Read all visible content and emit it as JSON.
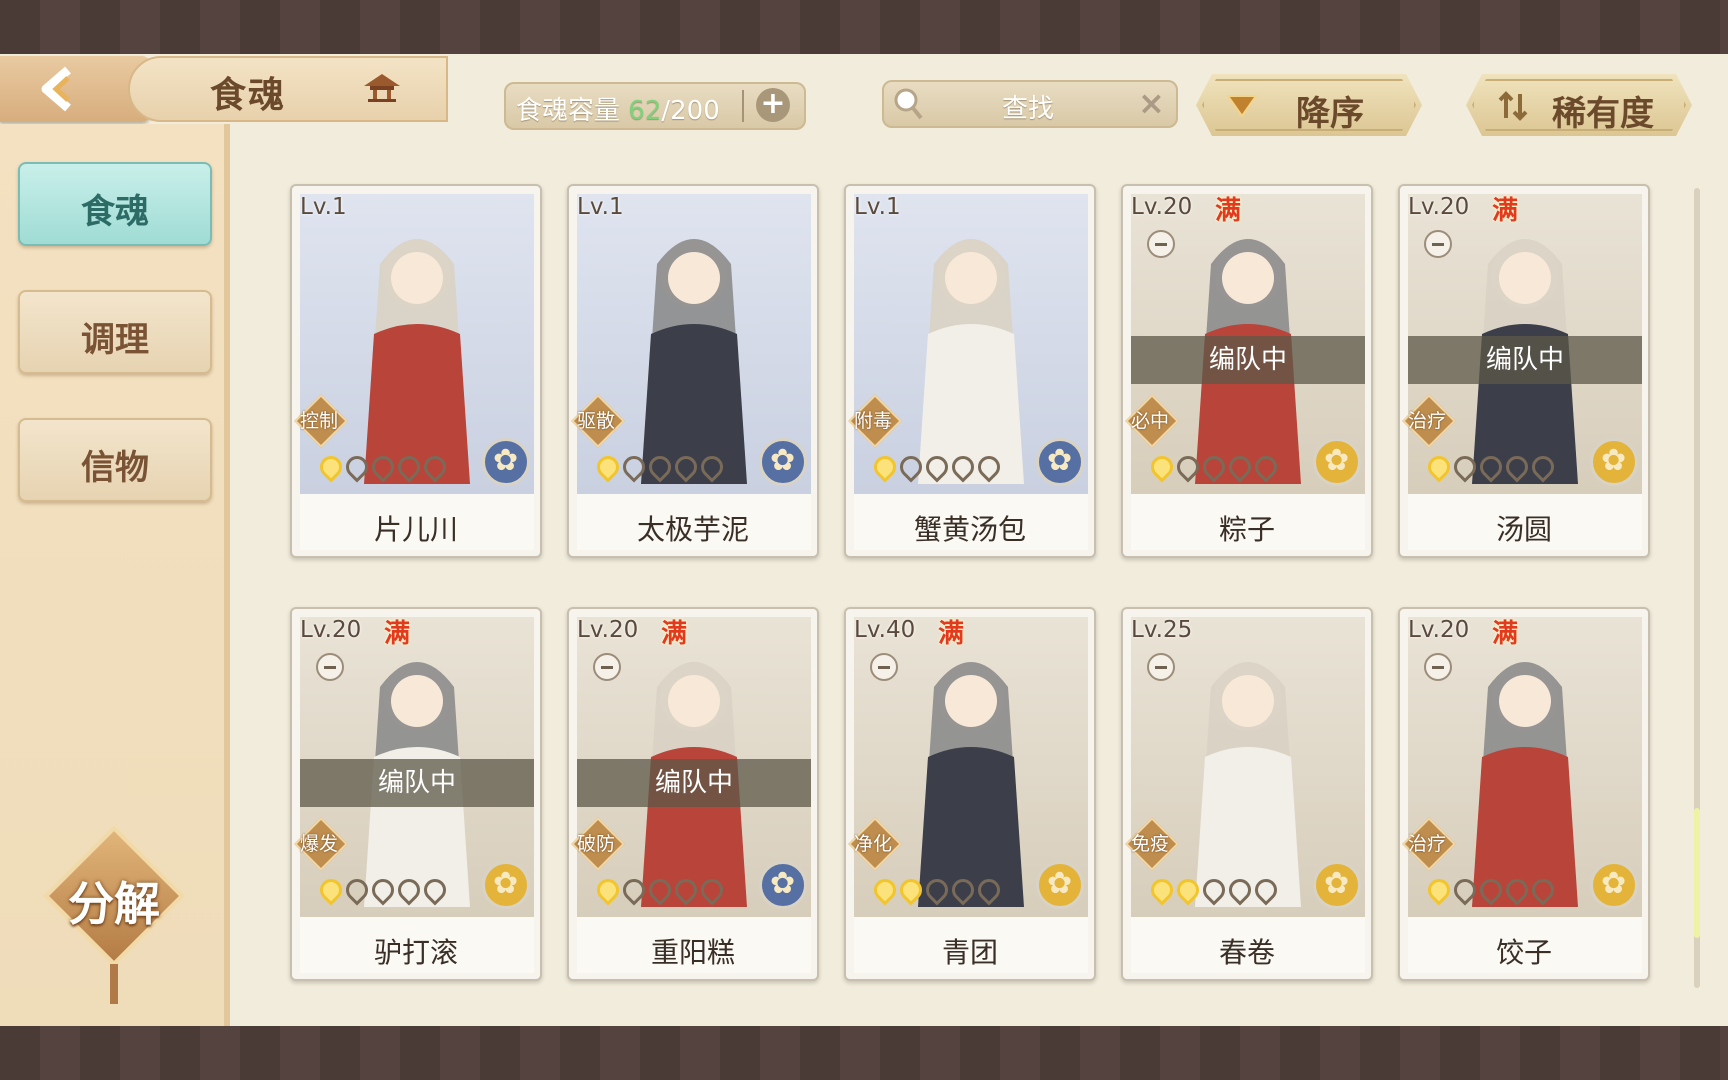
{
  "header": {
    "title": "食魂",
    "capacity_label": "食魂容量",
    "capacity_current": "62",
    "capacity_max": "/200",
    "search_placeholder": "查找",
    "sort_order_label": "降序",
    "sort_by_label": "稀有度"
  },
  "sidebar": {
    "items": [
      {
        "label": "食魂",
        "active": true
      },
      {
        "label": "调理",
        "active": false
      },
      {
        "label": "信物",
        "active": false
      }
    ],
    "decompose_label": "分解"
  },
  "cards": [
    {
      "level": "Lv.1",
      "full": "",
      "role": "控制",
      "stars": 0,
      "name": "片儿川",
      "element": "blue",
      "team": ""
    },
    {
      "level": "Lv.1",
      "full": "",
      "role": "驱散",
      "stars": 0,
      "name": "太极芋泥",
      "element": "blue",
      "team": ""
    },
    {
      "level": "Lv.1",
      "full": "",
      "role": "附毒",
      "stars": 0,
      "name": "蟹黄汤包",
      "element": "blue",
      "team": ""
    },
    {
      "level": "Lv.20",
      "full": "满",
      "role": "必中",
      "stars": 0,
      "name": "粽子",
      "element": "gold",
      "team": "编队中"
    },
    {
      "level": "Lv.20",
      "full": "满",
      "role": "治疗",
      "stars": 0,
      "name": "汤圆",
      "element": "gold",
      "team": "编队中"
    },
    {
      "level": "Lv.20",
      "full": "满",
      "role": "爆发",
      "stars": 0,
      "name": "驴打滚",
      "element": "gold",
      "team": "编队中"
    },
    {
      "level": "Lv.20",
      "full": "满",
      "role": "破防",
      "stars": 0,
      "name": "重阳糕",
      "element": "blue",
      "team": "编队中"
    },
    {
      "level": "Lv.40",
      "full": "满",
      "role": "净化",
      "stars": 1,
      "name": "青团",
      "element": "gold",
      "team": ""
    },
    {
      "level": "Lv.25",
      "full": "",
      "role": "免疫",
      "stars": 1,
      "name": "春卷",
      "element": "gold",
      "team": ""
    },
    {
      "level": "Lv.20",
      "full": "满",
      "role": "治疗",
      "stars": 0,
      "name": "饺子",
      "element": "gold",
      "team": ""
    }
  ],
  "colors": {
    "accent_teal": "#9fdcd4",
    "full_red": "#e23a1e",
    "capacity_green": "#7ed37a"
  }
}
